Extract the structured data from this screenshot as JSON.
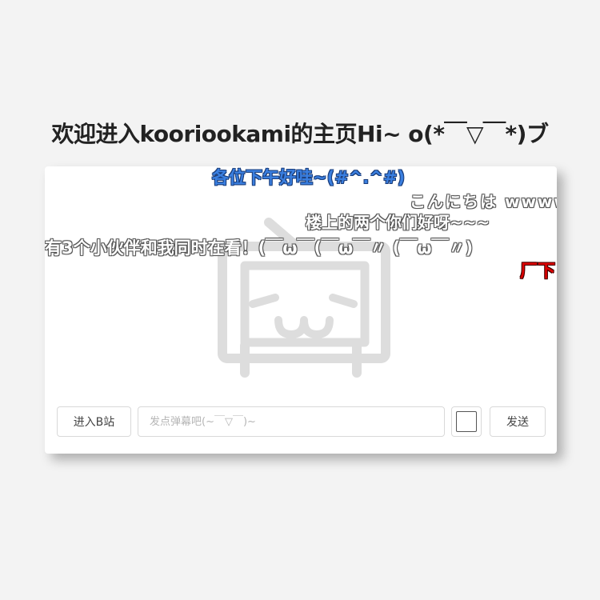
{
  "header": {
    "title": "欢迎进入kooriookami的主页Hi~ o(*￣▽￣*)ブ"
  },
  "danmaku": [
    {
      "text": "各位下午好哇~(#^.^#)",
      "color": "#3a7fe0"
    },
    {
      "text": "こんにちは wwwww",
      "color": "#ffffff"
    },
    {
      "text": "楼上的两个你们好呀~~~",
      "color": "#ffffff"
    },
    {
      "text": "有3个小伙伴和我同时在看！(￣ω￣(￣ω￣〃 (￣ω￣〃)",
      "color": "#ffffff"
    },
    {
      "text": "厂下",
      "color": "#e00000"
    }
  ],
  "mascot": {
    "icon": "bilibili-tv-icon",
    "color": "#dddddd"
  },
  "controls": {
    "enter_label": "进入B站",
    "input_placeholder": "发点弹幕吧(~￣▽￣)~",
    "input_value": "",
    "send_label": "发送",
    "selected_color": "#ffffff"
  }
}
